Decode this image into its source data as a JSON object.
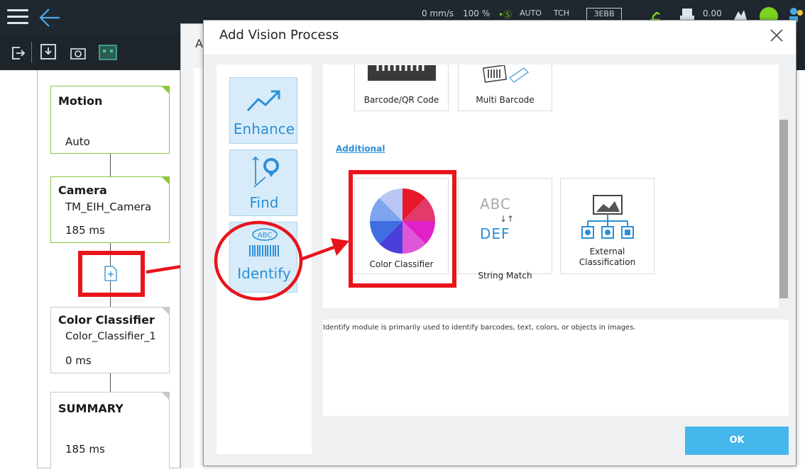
{
  "topbar": {
    "speed": "0 mm/s",
    "percent": "100 %",
    "mode_auto": "AUTO",
    "tcp": "TCH",
    "mode_box": "3EBB",
    "value": "0.00"
  },
  "flow": {
    "nodes": [
      {
        "title": "Motion",
        "sub": "Auto"
      },
      {
        "title": "Camera",
        "sub": "TM_EIH_Camera",
        "time": "185 ms"
      },
      {
        "title": "Color Classifier",
        "sub": "Color_Classifier_1",
        "time": "0 ms"
      },
      {
        "title": "SUMMARY",
        "time": "185 ms"
      }
    ]
  },
  "background_dialog": {
    "title_fragment": "A"
  },
  "dialog": {
    "title": "Add Vision Process",
    "categories": [
      {
        "label": "Enhance",
        "icon": "trend-icon"
      },
      {
        "label": "Find",
        "icon": "pin-icon"
      },
      {
        "label": "Identify",
        "icon": "barcode-abc-icon"
      }
    ],
    "tiles_top": [
      {
        "label": "Barcode/QR Code",
        "icon": "barcode-icon"
      },
      {
        "label": "Multi Barcode",
        "icon": "multi-barcode-icon"
      }
    ],
    "section_label": "Additional",
    "tiles_additional": [
      {
        "label": "Color Classifier",
        "icon": "color-wheel-icon"
      },
      {
        "label": "String Match",
        "icon": "abc-def-icon",
        "icon_top": "ABC",
        "icon_bottom": "DEF"
      },
      {
        "label": "External Classification",
        "icon": "image-tree-icon"
      }
    ],
    "description": "Identify module is primarily used to identify barcodes, text, colors, or objects in images.",
    "ok_label": "OK"
  },
  "colors": {
    "accent": "#2c8fd6",
    "ok_button": "#45b6ec",
    "annotation_red": "#e8141c",
    "node_green": "#8cc63f"
  }
}
